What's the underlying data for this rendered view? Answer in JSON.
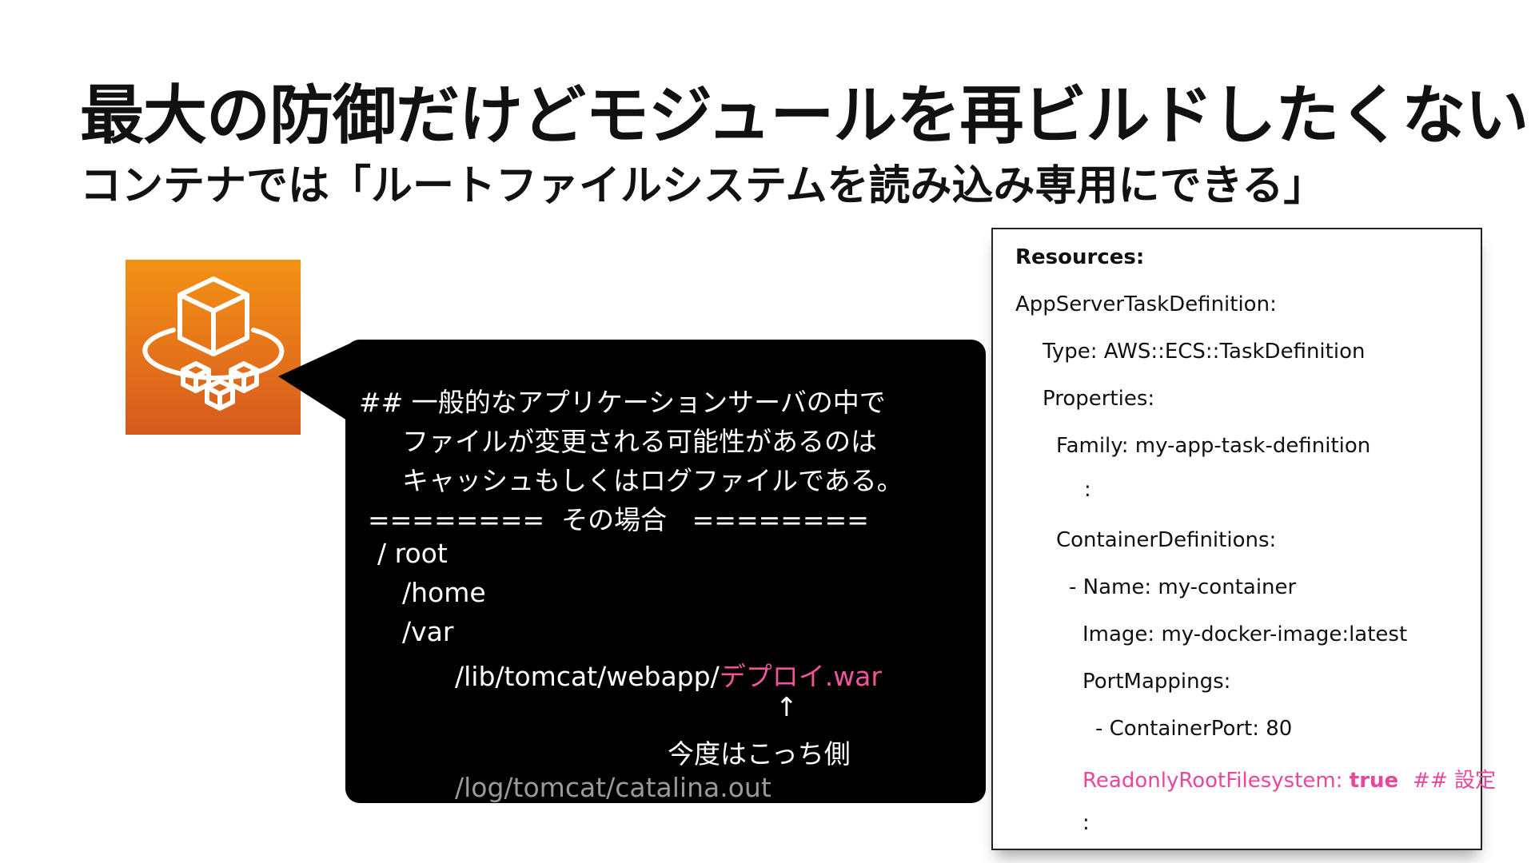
{
  "slide": {
    "title": "最大の防御だけどモジュールを再ビルドしたくない",
    "subtitle": "コンテナでは「ルートファイルシステムを読み込み専用にできる」"
  },
  "logo": {
    "icon": "container-service-icon",
    "colors": {
      "top": "#f39215",
      "bottom": "#d45a1c"
    }
  },
  "bubble": {
    "lines": [
      "## 一般的なアプリケーションサーバの中で",
      "ファイルが変更される可能性があるのは",
      "キャッシュもしくはログファイルである。",
      "========  その場合   ========",
      "/ root",
      "/home",
      "/var",
      "↑",
      "今度はこっち側",
      "/log/tomcat/catalina.out"
    ],
    "webapp_prefix": "/lib/tomcat/webapp/",
    "webapp_file": "デプロイ.war",
    "colors": {
      "highlight": "#f0559a",
      "muted": "#9a9a9a"
    }
  },
  "yaml": {
    "lines": [
      "Resources:",
      "AppServerTaskDefinition:",
      "Type: AWS::ECS::TaskDefinition",
      "Properties:",
      "Family: my-app-task-definition",
      ":",
      "ContainerDefinitions:",
      "- Name: my-container",
      "Image: my-docker-image:latest",
      "PortMappings:",
      "- ContainerPort: 80",
      ":"
    ],
    "readonly_key": "ReadonlyRootFilesystem: ",
    "readonly_value": "true",
    "readonly_comment": "## 設定",
    "colors": {
      "highlight": "#e8479a"
    }
  }
}
